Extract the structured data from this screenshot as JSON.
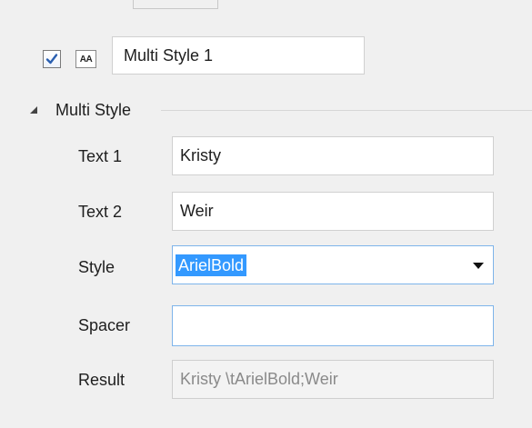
{
  "header": {
    "enabled": true,
    "type_icon_label": "AA",
    "name_value": "Multi Style 1"
  },
  "section": {
    "title": "Multi Style"
  },
  "fields": {
    "text1": {
      "label": "Text 1",
      "value": "Kristy"
    },
    "text2": {
      "label": "Text 2",
      "value": "Weir"
    },
    "style": {
      "label": "Style",
      "value": "ArielBold"
    },
    "spacer": {
      "label": "Spacer",
      "value": ""
    },
    "result": {
      "label": "Result",
      "value": "Kristy \\tArielBold;Weir"
    }
  },
  "icons": {
    "checkbox": "checkbox-checked-icon",
    "text_type": "text-style-icon",
    "collapse": "collapse-triangle-icon",
    "dropdown": "chevron-down-icon"
  },
  "colors": {
    "background": "#f0f0f0",
    "selection": "#3399ff",
    "focus_border": "#7eb4ea",
    "check": "#2a5fb0"
  }
}
